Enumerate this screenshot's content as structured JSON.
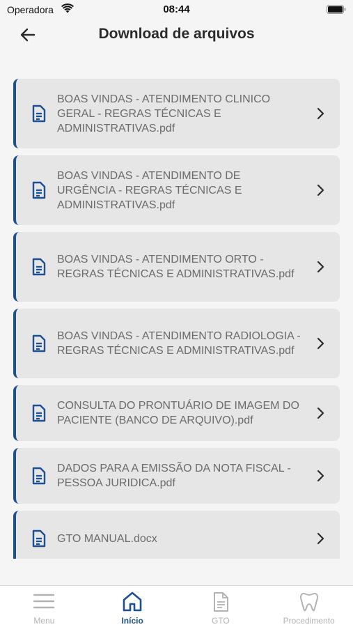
{
  "status_bar": {
    "carrier": "Operadora",
    "time": "08:44"
  },
  "header": {
    "title": "Download de arquivos"
  },
  "files": [
    {
      "name": "BOAS VINDAS - ATENDIMENTO CLINICO GERAL - REGRAS TÉCNICAS E ADMINISTRATIVAS.pdf"
    },
    {
      "name": "BOAS VINDAS - ATENDIMENTO DE URGÊNCIA - REGRAS TÉCNICAS E ADMINISTRATIVAS.pdf"
    },
    {
      "name": "BOAS VINDAS - ATENDIMENTO ORTO - REGRAS TÉCNICAS E ADMINISTRATIVAS.pdf"
    },
    {
      "name": "BOAS VINDAS - ATENDIMENTO RADIOLOGIA - REGRAS TÉCNICAS E ADMINISTRATIVAS.pdf"
    },
    {
      "name": "CONSULTA DO PRONTUÁRIO DE IMAGEM DO PACIENTE (BANCO DE ARQUIVO).pdf"
    },
    {
      "name": "DADOS PARA A EMISSÃO DA NOTA FISCAL - PESSOA JURIDICA.pdf"
    },
    {
      "name": "GTO MANUAL.docx"
    }
  ],
  "tabs": [
    {
      "label": "Menu",
      "icon": "hamburger-menu-icon",
      "active": false
    },
    {
      "label": "Início",
      "icon": "home-icon",
      "active": true
    },
    {
      "label": "GTO",
      "icon": "document-icon",
      "active": false
    },
    {
      "label": "Procedimento",
      "icon": "tooth-icon",
      "active": false
    }
  ],
  "colors": {
    "accent": "#1d4f91",
    "card_background": "#e6e6e6",
    "page_background": "#f5f5f5",
    "inactive_tab": "#b3b3b3"
  }
}
